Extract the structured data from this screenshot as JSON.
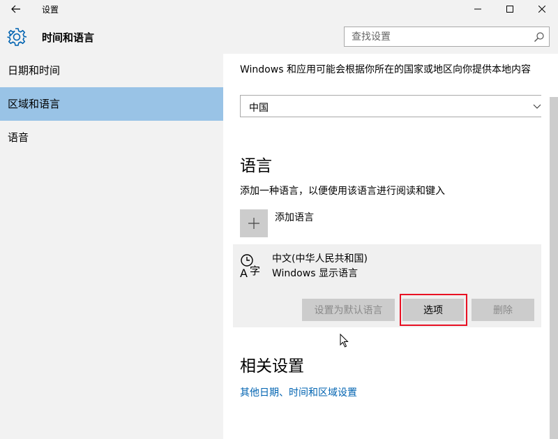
{
  "window": {
    "title": "设置"
  },
  "header": {
    "page_title": "时间和语言",
    "search_placeholder": "查找设置"
  },
  "sidebar": {
    "items": [
      {
        "label": "日期和时间",
        "active": false
      },
      {
        "label": "区域和语言",
        "active": true
      },
      {
        "label": "语音",
        "active": false
      }
    ]
  },
  "content": {
    "region": {
      "description": "Windows 和应用可能会根据你所在的国家或地区向你提供本地内容",
      "selected_value": "中国"
    },
    "language_section": {
      "heading": "语言",
      "description": "添加一种语言，以便使用该语言进行阅读和键入",
      "add_language_label": "添加语言",
      "language_item": {
        "name": "中文(中华人民共和国)",
        "subtitle": "Windows 显示语言",
        "set_default_label": "设置为默认语言",
        "options_label": "选项",
        "remove_label": "删除"
      }
    },
    "related_section": {
      "heading": "相关设置",
      "link_label": "其他日期、时间和区域设置"
    }
  },
  "colors": {
    "accent": "#99c3e6",
    "link": "#0063b1",
    "highlight": "#e81123"
  }
}
